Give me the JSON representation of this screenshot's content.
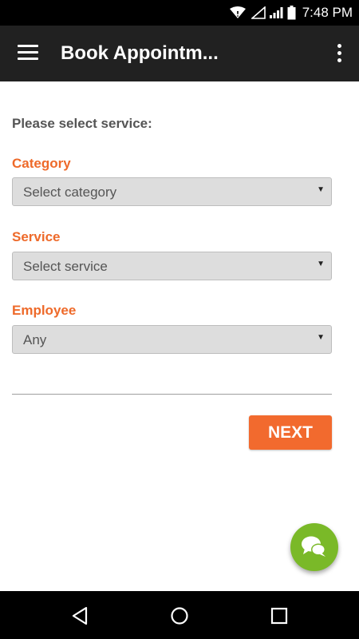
{
  "status_bar": {
    "time": "7:48 PM"
  },
  "app_bar": {
    "title": "Book Appointm..."
  },
  "form": {
    "intro": "Please select service:",
    "category": {
      "label": "Category",
      "value": "Select category"
    },
    "service": {
      "label": "Service",
      "value": "Select service"
    },
    "employee": {
      "label": "Employee",
      "value": "Any"
    },
    "dropdown_arrow": "▼",
    "next_label": "NEXT"
  },
  "colors": {
    "accent": "#ee6a2a",
    "button": "#f26a2e",
    "fab": "#7ab928",
    "toolbar": "#212121"
  },
  "icons": {
    "menu": "menu-icon",
    "overflow": "more-vert-icon",
    "chat": "chat-bubbles-icon",
    "back": "back-triangle-icon",
    "home": "home-circle-icon",
    "recents": "recents-square-icon"
  }
}
